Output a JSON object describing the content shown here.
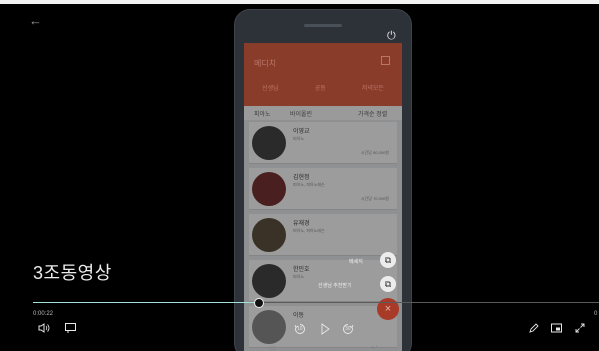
{
  "player": {
    "title": "3조동영상",
    "time_current": "0:00:22",
    "time_total": "0",
    "progress_fraction": 0.4,
    "accent_color": "#9fe2dc"
  },
  "app": {
    "header_title": "메디치",
    "tabs": [
      "선생님",
      "공동",
      "저녁모든"
    ],
    "filter": {
      "left1": "피아노",
      "left2": "바이올린",
      "right": "가격순 정렬"
    },
    "teachers": [
      {
        "name": "이영교",
        "sub": "피아노",
        "price": "시간당 80,000원"
      },
      {
        "name": "김현정",
        "sub": "피아노, 피아노레슨",
        "price": "시간당 70,000원"
      },
      {
        "name": "유재경",
        "sub": "피아노, 피아노레슨",
        "price": ""
      },
      {
        "name": "한민호",
        "sub": "피아노",
        "price": ""
      },
      {
        "name": "이동",
        "sub": "",
        "price": ""
      }
    ],
    "float_actions": [
      {
        "label": "메세지",
        "icon": "open-external-icon"
      },
      {
        "label": "선생님 추천받기",
        "icon": "open-external-icon"
      }
    ],
    "fab_icon": "close-icon"
  },
  "controls": {
    "back": "←",
    "volume_icon": "volume-icon",
    "captions_icon": "captions-icon",
    "rewind_label": "10",
    "forward_label": "30",
    "pen_icon": "pen-icon",
    "miniview_icon": "miniview-icon",
    "fullscreen_icon": "fullscreen-icon"
  }
}
